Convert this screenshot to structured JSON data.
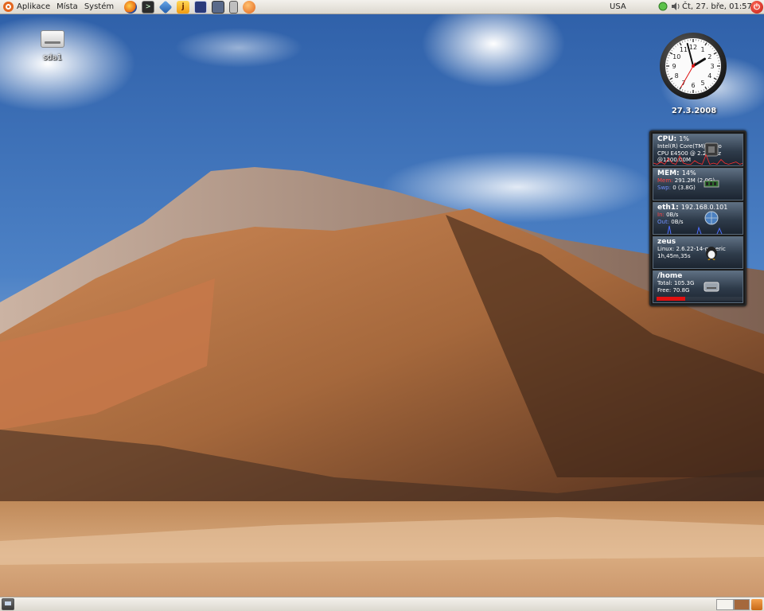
{
  "top_panel": {
    "menus": [
      {
        "label": "Aplikace"
      },
      {
        "label": "Místa"
      },
      {
        "label": "Systém"
      }
    ],
    "launchers": [
      {
        "icon": "firefox-icon"
      },
      {
        "icon": "terminal-icon"
      },
      {
        "icon": "virtualbox-icon"
      },
      {
        "icon": "java-icon"
      },
      {
        "icon": "screenshot-icon"
      },
      {
        "icon": "save-icon"
      },
      {
        "icon": "mobile-icon"
      },
      {
        "icon": "media-icon"
      }
    ],
    "keyboard_layout": "USA",
    "tray": [
      {
        "icon": "network-icon"
      },
      {
        "icon": "volume-icon"
      }
    ],
    "clock": "Čt, 27. bře, 01:57",
    "shutdown_icon": "power-icon"
  },
  "desktop": {
    "icons": [
      {
        "label": "sda1",
        "icon": "drive-icon"
      }
    ]
  },
  "clock_widget": {
    "date": "27.3.2008",
    "hour": 1,
    "minute": 57,
    "second": 35
  },
  "sysmon": {
    "cpu": {
      "title": "CPU:",
      "value": "1%",
      "model": "Intel(R) Core(TM)2 Duo",
      "line2": "CPU     E4500  @ 2.20GHz",
      "line3": "@1200.00M",
      "samples": [
        2,
        1,
        3,
        1,
        6,
        2,
        1,
        8,
        2,
        1,
        1,
        4,
        2,
        1,
        9,
        1,
        2,
        1,
        5,
        2,
        1,
        2,
        3,
        1,
        2,
        1
      ]
    },
    "mem": {
      "title": "MEM:",
      "value": "14%",
      "mem_label": "Mem:",
      "mem_value": "291.2M (2.0G)",
      "swap_label": "Swp:",
      "swap_value": "0 (3.8G)"
    },
    "net": {
      "title": "eth1:",
      "value": "192.168.0.101",
      "in_label": "In:",
      "in_value": "0B/s",
      "out_label": "Out:",
      "out_value": "0B/s"
    },
    "host": {
      "title": "zeus",
      "kernel": "Linux: 2.6.22-14-generic",
      "uptime": "1h,45m,35s"
    },
    "disk": {
      "title": "/home",
      "total_label": "Total:",
      "total_value": "105.3G",
      "free_label": "Free:",
      "free_value": "70.8G",
      "used_fraction": 0.33
    }
  },
  "bottom_panel": {
    "show_desktop_icon": "show-desktop-icon",
    "workspaces": [
      {
        "name": "workspace-1"
      },
      {
        "name": "workspace-2"
      }
    ],
    "trash_icon": "trash-icon"
  },
  "colors": {
    "sky": "#3d73be",
    "panel": "#e7e4dd",
    "accent_red": "#e01010",
    "ubuntu_orange": "#e2661f"
  }
}
